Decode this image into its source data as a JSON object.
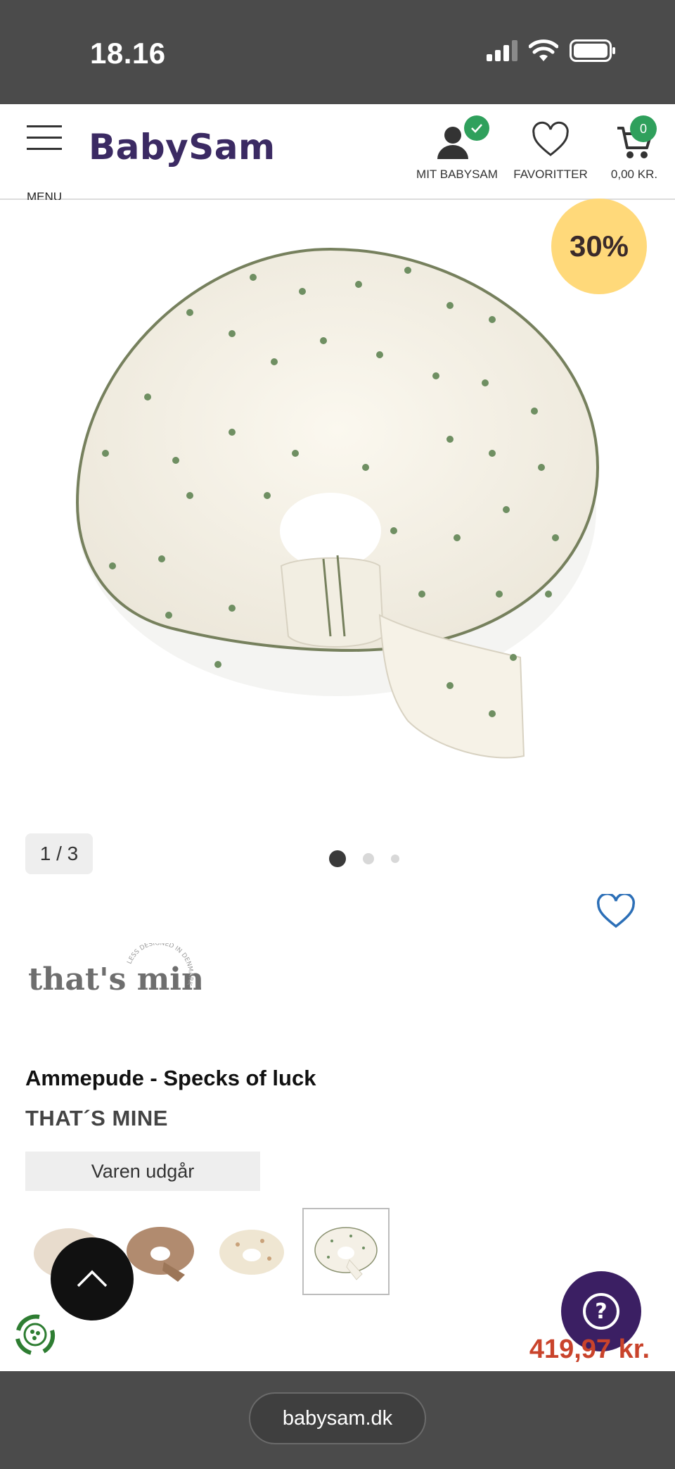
{
  "status_bar": {
    "time": "18.16"
  },
  "header": {
    "menu_label": "MENU",
    "logo_text": "BabySam",
    "account_label": "MIT BABYSAM",
    "favorites_label": "FAVORITTER",
    "cart_label": "0,00 KR.",
    "cart_count": "0",
    "brand_color": "#3b2a63",
    "badge_color": "#2fa05c"
  },
  "gallery": {
    "discount_badge": "30%",
    "counter": "1 / 3",
    "dots_total": 3,
    "active_dot": 1
  },
  "product": {
    "brand_logo_text": "that's mine",
    "brand_logo_small": "LESS DESIGNED IN DENMARK",
    "title": "Ammepude - Specks of luck",
    "brand": "THAT´S MINE",
    "availability": "Varen udgår",
    "price": "419,97 kr.",
    "price_color": "#c9432b",
    "variants": [
      {
        "name": "beige"
      },
      {
        "name": "brown"
      },
      {
        "name": "floral-cream"
      },
      {
        "name": "specks-of-luck",
        "selected": true
      }
    ]
  },
  "floating": {
    "scroll_top_icon": "chevron-up-icon",
    "help_icon": "question-icon",
    "eco_icon": "recycle-icon"
  },
  "browser": {
    "url": "babysam.dk"
  }
}
